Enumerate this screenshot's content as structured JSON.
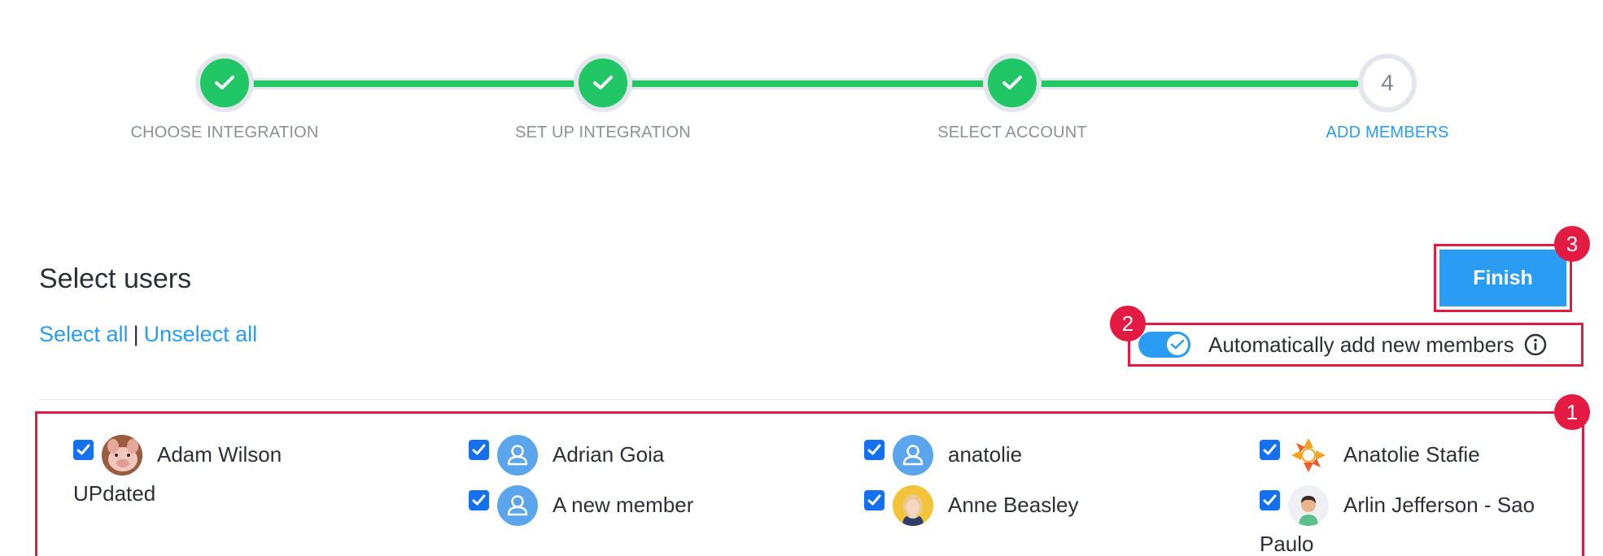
{
  "stepper": {
    "steps": [
      {
        "label": "CHOOSE INTEGRATION",
        "status": "done"
      },
      {
        "label": "SET UP INTEGRATION",
        "status": "done"
      },
      {
        "label": "SELECT ACCOUNT",
        "status": "done"
      },
      {
        "label": "ADD MEMBERS",
        "status": "current",
        "number": "4"
      }
    ],
    "colors": {
      "done": "#21c764",
      "active": "#2a9cf3"
    }
  },
  "header": {
    "title": "Select users",
    "select_all": "Select all",
    "separator": "|",
    "unselect_all": "Unselect all"
  },
  "finish_label": "Finish",
  "auto_add": {
    "label": "Automatically add new members",
    "enabled": true
  },
  "badges": [
    "1",
    "2",
    "3"
  ],
  "users": [
    {
      "name": "Adam Wilson UPdated",
      "checked": true,
      "avatar": "pig-photo"
    },
    {
      "name": "Adrian Goia",
      "checked": true,
      "avatar": "default-user-icon"
    },
    {
      "name": "anatolie",
      "checked": true,
      "avatar": "default-user-icon"
    },
    {
      "name": "Anatolie Stafie",
      "checked": true,
      "avatar": "sun-logo"
    },
    {
      "name": "A new member",
      "checked": true,
      "avatar": "default-user-icon"
    },
    {
      "name": "Anne Beasley",
      "checked": true,
      "avatar": "woman-photo"
    },
    {
      "name": "Arlin Jefferson - Sao Paulo",
      "checked": true,
      "avatar": "man-avatar"
    }
  ],
  "colors": {
    "accent": "#2a9cf3",
    "highlight": "#e31b43",
    "checkbox": "#1570ef"
  }
}
